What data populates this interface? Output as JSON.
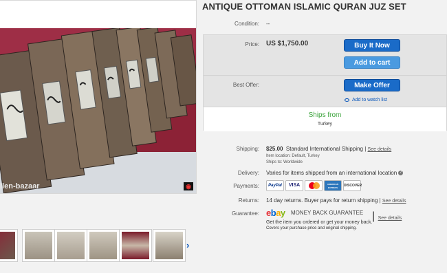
{
  "listing": {
    "title": "ANTIQUE OTTOMAN ISLAMIC QURAN JUZ SET",
    "watermark": "llen-bazaar",
    "condition_label": "Condition:",
    "condition_value": "--",
    "price_label": "Price:",
    "price_value": "US $1,750.00",
    "best_offer_label": "Best Offer:"
  },
  "buttons": {
    "buy_now": "Buy It Now",
    "add_to_cart": "Add to cart",
    "make_offer": "Make Offer",
    "watch_list": "Add to watch list"
  },
  "ships_from": {
    "heading": "Ships from",
    "country": "Turkey"
  },
  "shipping": {
    "label": "Shipping:",
    "cost": "$25.00",
    "method": "Standard International Shipping",
    "see_details": "See details",
    "item_location": "Item location:  Default, Turkey",
    "ships_to": "Ships to:  Worldwide"
  },
  "delivery": {
    "label": "Delivery:",
    "value": "Varies for items shipped from an international location",
    "info_icon": "?"
  },
  "payments": {
    "label": "Payments:",
    "methods": [
      "PayPal",
      "VISA",
      "MasterCard",
      "AMERICAN EXPRESS",
      "DISCOVER"
    ]
  },
  "returns": {
    "label": "Returns:",
    "value": "14 day returns. Buyer pays for return shipping",
    "see_details": "See details"
  },
  "guarantee": {
    "label": "Guarantee:",
    "logo_letters": [
      "e",
      "b",
      "a",
      "y"
    ],
    "title": "MONEY BACK GUARANTEE",
    "see_details": "See details",
    "line1": "Get the item you ordered or get your money back.",
    "line2": "Covers your purchase price and original shipping."
  },
  "gallery": {
    "thumbnail_count": 7,
    "next_arrow": "›"
  },
  "colors": {
    "buy_button": "#1a6bc8",
    "cart_button": "#4a9ae0",
    "ships_from_green": "#3ba33b",
    "link_blue": "#0654ba"
  }
}
